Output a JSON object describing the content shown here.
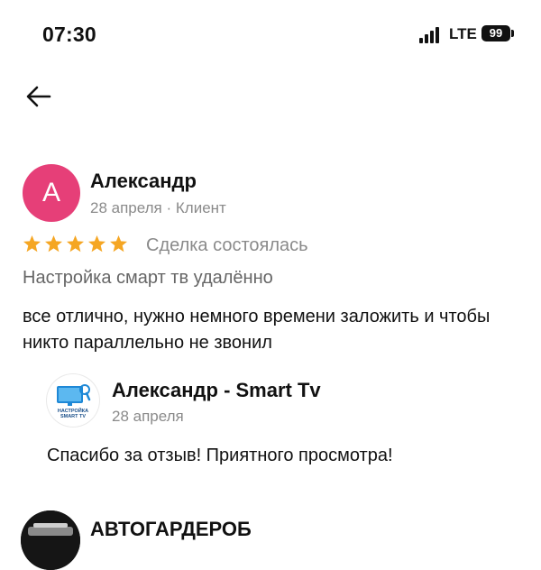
{
  "status_bar": {
    "time": "07:30",
    "network": "LTE",
    "battery": "99"
  },
  "nav": {
    "back_icon": "arrow-left-icon"
  },
  "review": {
    "avatar_letter": "А",
    "avatar_color": "#e63f78",
    "author": "Александр",
    "meta": "28 апреля · Клиент",
    "rating": 5,
    "star_color": "#f5a623",
    "deal_status": "Сделка состоялась",
    "service": "Настройка смарт тв удалённо",
    "text": "все отлично, нужно немного времени заложить и чтобы никто параллельно не звонил"
  },
  "reply": {
    "logo_lines": [
      "НАСТРОЙКА",
      "SMART TV"
    ],
    "author": "Александр - Smart Tv",
    "date": "28 апреля",
    "text": "Спасибо за отзыв! Приятного просмотра!"
  },
  "next_review": {
    "author": "АВТОГАРДЕРОБ"
  }
}
